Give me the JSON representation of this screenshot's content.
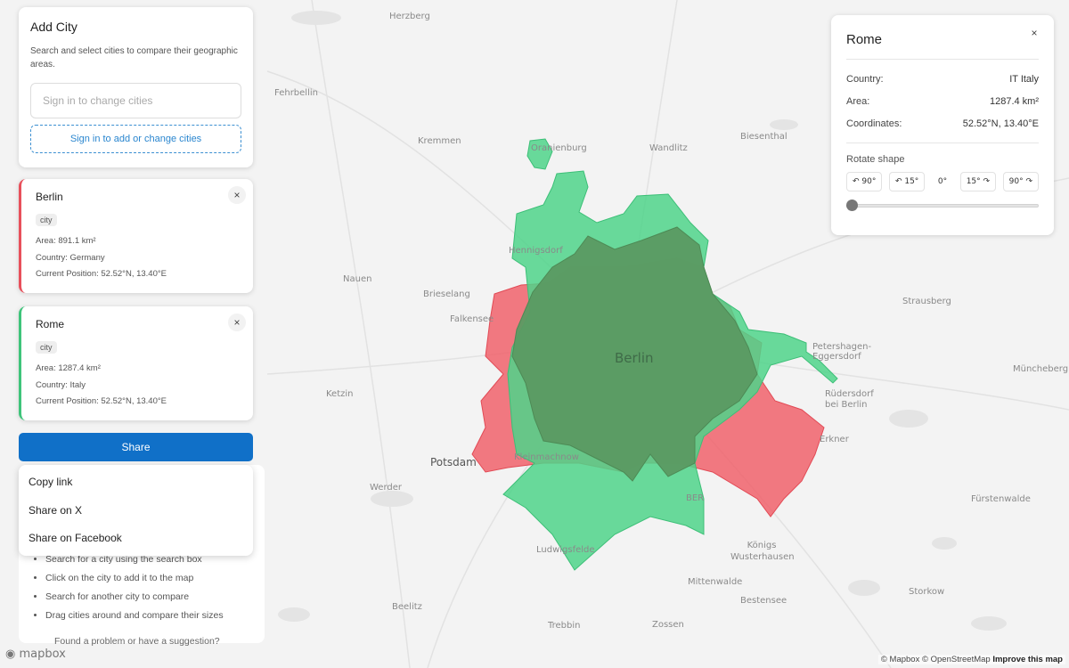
{
  "add_city": {
    "title": "Add City",
    "description": "Search and select cities to compare their geographic areas.",
    "search_placeholder": "Sign in to change cities",
    "signin_button": "Sign in to add or change cities"
  },
  "cities": [
    {
      "name": "Berlin",
      "tag": "city",
      "area": "Area: 891.1 km²",
      "country": "Country: Germany",
      "position": "Current Position: 52.52°N, 13.40°E",
      "color": "#e8505b"
    },
    {
      "name": "Rome",
      "tag": "city",
      "area": "Area: 1287.4 km²",
      "country": "Country: Italy",
      "position": "Current Position: 52.52°N, 13.40°E",
      "color": "#3ec47a"
    }
  ],
  "close_glyph": "×",
  "share": {
    "button": "Share",
    "menu": [
      "Copy link",
      "Share on X",
      "Share on Facebook"
    ]
  },
  "instructions": {
    "items": [
      "Search for a city using the search box",
      "Click on the city to add it to the map",
      "Search for another city to compare",
      "Drag cities around and compare their sizes"
    ],
    "footer": "Found a problem or have a suggestion?"
  },
  "info": {
    "title": "Rome",
    "country_label": "Country:",
    "country_value": "IT Italy",
    "area_label": "Area:",
    "area_value": "1287.4 km²",
    "coords_label": "Coordinates:",
    "coords_value": "52.52°N, 13.40°E",
    "rotate_title": "Rotate shape",
    "rotate_buttons": [
      "↶ 90°",
      "↶ 15°",
      "0°",
      "15° ↷",
      "90° ↷"
    ],
    "rotation_value": 0
  },
  "map": {
    "labels": {
      "herzberg": "Herzberg",
      "fehrbellin": "Fehrbellin",
      "kremmen": "Kremmen",
      "oranienburg": "Oranienburg",
      "wandlitz": "Wandlitz",
      "biesenthal": "Biesenthal",
      "hennigsdorf": "Hennigsdorf",
      "nauen": "Nauen",
      "brieselang": "Brieselang",
      "falkensee": "Falkensee",
      "berlin": "Berlin",
      "strausberg": "Strausberg",
      "petershagen": "Petershagen-Eggersdorf",
      "muncheberg": "Müncheberg",
      "rudersdorf": "Rüdersdorf bei Berlin",
      "ketzin": "Ketzin",
      "potsdam": "Potsdam",
      "kleinmachnow": "Kleinmachnow",
      "werder": "Werder",
      "erkner": "Erkner",
      "ber": "BER",
      "furstenwalde": "Fürstenwalde",
      "ludwigsfelde": "Ludwigsfelde",
      "konigs": "Königs Wusterhausen",
      "mittenwalde": "Mittenwalde",
      "storkow": "Storkow",
      "beelitz": "Beelitz",
      "bestensee": "Bestensee",
      "trebbin": "Trebbin",
      "zossen": "Zossen"
    },
    "colors": {
      "berlin": "#f0616b",
      "rome": "#4fd38a",
      "overlap": "#5b9a62"
    }
  },
  "footer": {
    "logo": "mapbox",
    "attribution": "© Mapbox © OpenStreetMap",
    "improve": "Improve this map"
  }
}
